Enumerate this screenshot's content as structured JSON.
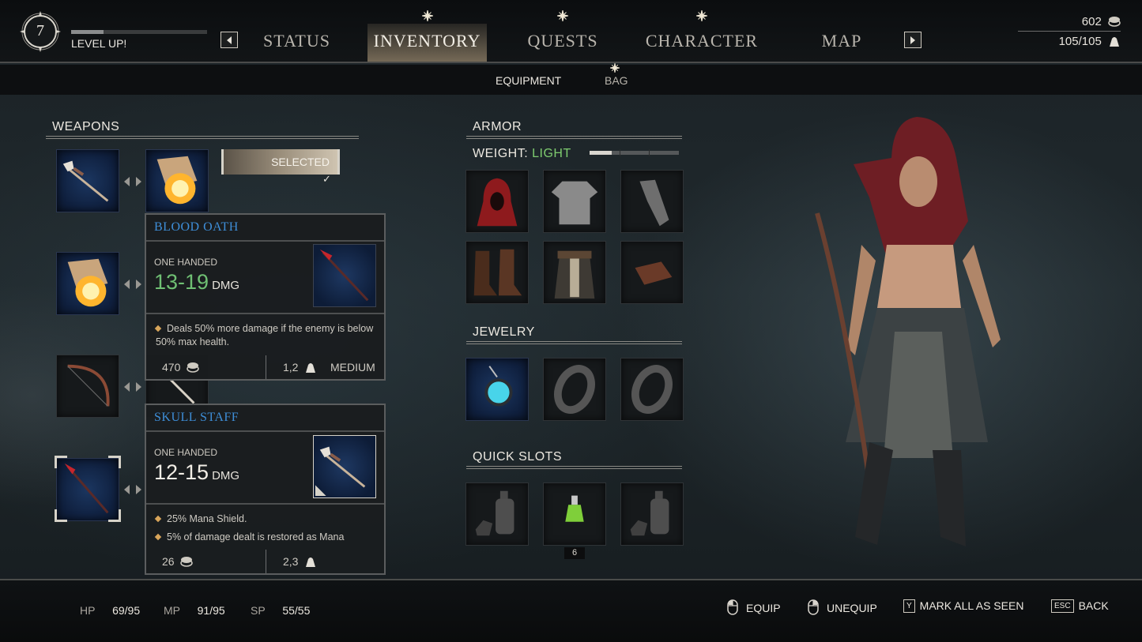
{
  "player": {
    "level": "7",
    "level_up": "LEVEL UP!",
    "xp_progress": 0.24
  },
  "nav": {
    "tabs": [
      {
        "label": "STATUS",
        "new": false,
        "active": false
      },
      {
        "label": "INVENTORY",
        "new": true,
        "active": true
      },
      {
        "label": "QUESTS",
        "new": true,
        "active": false
      },
      {
        "label": "CHARACTER",
        "new": true,
        "active": false
      },
      {
        "label": "MAP",
        "new": false,
        "active": false
      }
    ],
    "prev_icon": "arrow-left-icon",
    "next_icon": "arrow-right-icon"
  },
  "resources": {
    "gold": "602",
    "carry_weight": "105/105"
  },
  "subtabs": [
    {
      "label": "EQUIPMENT",
      "active": true,
      "new": false
    },
    {
      "label": "BAG",
      "active": false,
      "new": true
    }
  ],
  "weapons": {
    "title": "WEAPONS",
    "selected_label": "SELECTED",
    "check": "✓",
    "slots": [
      {
        "main": "skull-staff-icon",
        "off": "fire-scroll-icon"
      },
      {
        "main": "fire-scroll-icon",
        "off": ""
      },
      {
        "main": "bow-icon",
        "off": "arrow-icon"
      },
      {
        "main": "blood-spear-icon",
        "off": ""
      }
    ]
  },
  "tooltips": [
    {
      "name": "BLOOD OATH",
      "type": "ONE HANDED",
      "damage": "13-19",
      "damage_unit": "DMG",
      "damage_color": "#6fbf73",
      "effects": [
        "Deals 50% more damage if the enemy is below 50% max health."
      ],
      "value": "470",
      "weight": "1,2",
      "weight_class": "MEDIUM"
    },
    {
      "name": "SKULL STAFF",
      "type": "ONE HANDED",
      "damage": "12-15",
      "damage_unit": "DMG",
      "damage_color": "#f2eee6",
      "effects": [
        "25% Mana Shield.",
        "5% of damage dealt is restored as Mana"
      ],
      "value": "26",
      "weight": "2,3",
      "weight_class": ""
    }
  ],
  "armor": {
    "title": "ARMOR",
    "weight_label": "WEIGHT:",
    "weight_value": "LIGHT",
    "weight_color": "#7ecb6f",
    "weight_level": 0.25,
    "slots": [
      "red-hood-icon",
      "shirt-icon",
      "cloak-icon",
      "boots-icon",
      "belt-skirt-icon",
      "bracer-icon"
    ]
  },
  "jewelry": {
    "title": "JEWELRY",
    "slots": [
      "amulet-icon",
      "ring-icon",
      "ring-icon"
    ]
  },
  "quick_slots": {
    "title": "QUICK SLOTS",
    "slots": [
      "potion-empty-icon",
      "green-potion-icon",
      "potion-empty-icon"
    ],
    "quantity": "6"
  },
  "stats": [
    {
      "label": "HP",
      "value": "69/95"
    },
    {
      "label": "MP",
      "value": "91/95"
    },
    {
      "label": "SP",
      "value": "55/55"
    }
  ],
  "hints": [
    {
      "key": "mouse-left-icon",
      "label": "EQUIP"
    },
    {
      "key": "mouse-right-icon",
      "label": "UNEQUIP"
    },
    {
      "key": "Y",
      "label": "MARK ALL AS SEEN"
    },
    {
      "key": "ESC",
      "label": "BACK"
    }
  ]
}
